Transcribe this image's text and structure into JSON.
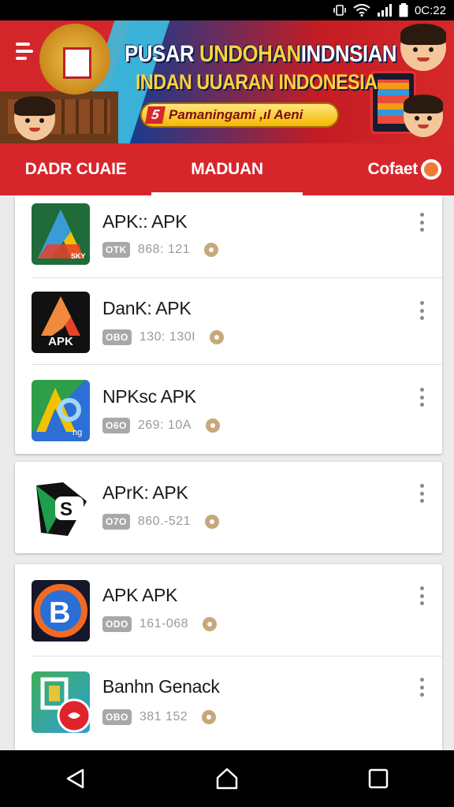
{
  "status_bar": {
    "time": "0C:22"
  },
  "banner": {
    "title_part1": "PUSAR ",
    "title_highlight": "UNDOHAN",
    "title_part2": "INDNSIAN",
    "subtitle": "INDAN UUARAN INDONESIA",
    "cta_number": "5",
    "cta_text": "Pamaningami ,ıl Aeni"
  },
  "tabs": [
    {
      "label": "DADR CUAIE",
      "active": false
    },
    {
      "label": "MADUAN",
      "active": true
    },
    {
      "label": "Cofaet",
      "active": false
    }
  ],
  "cards": [
    {
      "items": [
        {
          "name": "APK:: APK",
          "tag": "OTK",
          "size": "868: 121",
          "icon": "apk-icon-green",
          "icon_caption": ""
        },
        {
          "name": "DanK: APK",
          "tag": "OBO",
          "size": "130: 130I",
          "icon": "apk-icon-red-a",
          "icon_caption": "APK"
        },
        {
          "name": "NPKsc APK",
          "tag": "O6O",
          "size": "269: 10A",
          "icon": "apk-icon-blue-a",
          "icon_caption": ""
        }
      ]
    },
    {
      "items": [
        {
          "name": "APrK: APK",
          "tag": "O7O",
          "size": "860.-521",
          "icon": "apk-icon-s-logo",
          "icon_caption": ""
        }
      ]
    },
    {
      "items": [
        {
          "name": "APK APK",
          "tag": "ODO",
          "size": "161-068",
          "icon": "apk-icon-orange-b",
          "icon_caption": ""
        },
        {
          "name": "Banhn Genack",
          "tag": "OBO",
          "size": "381 152",
          "icon": "apk-icon-green-frame",
          "icon_caption": ""
        }
      ]
    }
  ],
  "colors": {
    "primary": "#d7262b",
    "banner_blue": "#1e3a8a",
    "cta_yellow": "#f5b800"
  }
}
